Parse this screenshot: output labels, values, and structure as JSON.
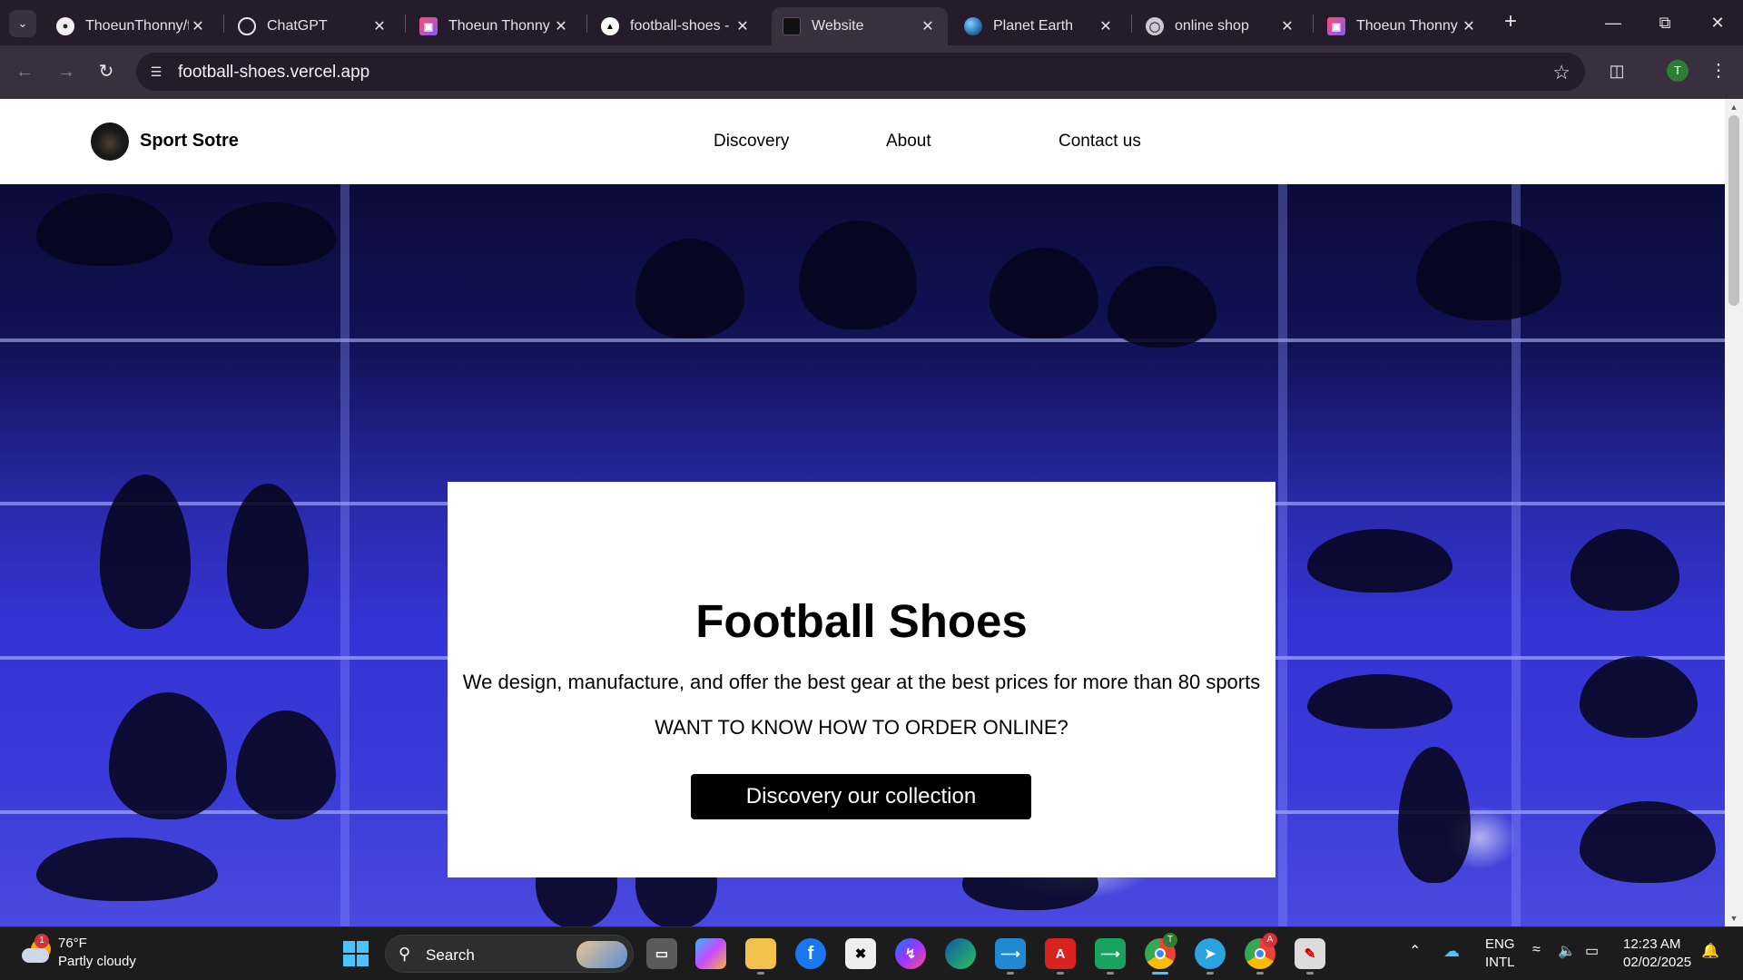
{
  "browser": {
    "tabs": [
      {
        "title": "ThoeunThonny/f",
        "favicon": "github-icon",
        "active": false
      },
      {
        "title": "ChatGPT",
        "favicon": "chatgpt-icon",
        "active": false
      },
      {
        "title": "Thoeun Thonny",
        "favicon": "portfolio-icon",
        "active": false
      },
      {
        "title": "football-shoes -",
        "favicon": "vercel-icon",
        "active": false
      },
      {
        "title": "Website",
        "favicon": "website-icon",
        "active": true
      },
      {
        "title": "Planet Earth",
        "favicon": "earth-icon",
        "active": false
      },
      {
        "title": "online shop",
        "favicon": "globe-icon",
        "active": false
      },
      {
        "title": "Thoeun Thonny",
        "favicon": "portfolio-icon",
        "active": false
      }
    ],
    "url": "football-shoes.vercel.app",
    "profile_initial": "T"
  },
  "site": {
    "brand": "Sport Sotre",
    "nav": [
      "Discovery",
      "About",
      "Contact us"
    ],
    "hero": {
      "title": "Football Shoes",
      "description": "We design, manufacture, and offer the best gear at the best prices for more than 80 sports",
      "question": "WANT TO KNOW HOW TO ORDER ONLINE?",
      "cta": "Discovery our collection"
    }
  },
  "taskbar": {
    "weather": {
      "temp": "76°F",
      "desc": "Partly cloudy",
      "badge": "1"
    },
    "search_label": "Search",
    "apps": [
      "task-view",
      "copilot",
      "file-explorer",
      "facebook",
      "capcut",
      "messenger",
      "edge",
      "vscode",
      "acrobat",
      "vscode-insiders",
      "chrome",
      "telegram",
      "chrome-alt",
      "notepad"
    ],
    "chrome_badge": "T",
    "chrome_alt_badge": "A",
    "lang": "ENG",
    "layout": "INTL",
    "time": "12:23 AM",
    "date": "02/02/2025"
  },
  "colors": {
    "tabstrip": "#261b2b",
    "toolbar": "#3a2f3f",
    "hero_blue": "#3434d6",
    "taskbar": "#1c1c1c",
    "accent": "#4cc2ff"
  }
}
